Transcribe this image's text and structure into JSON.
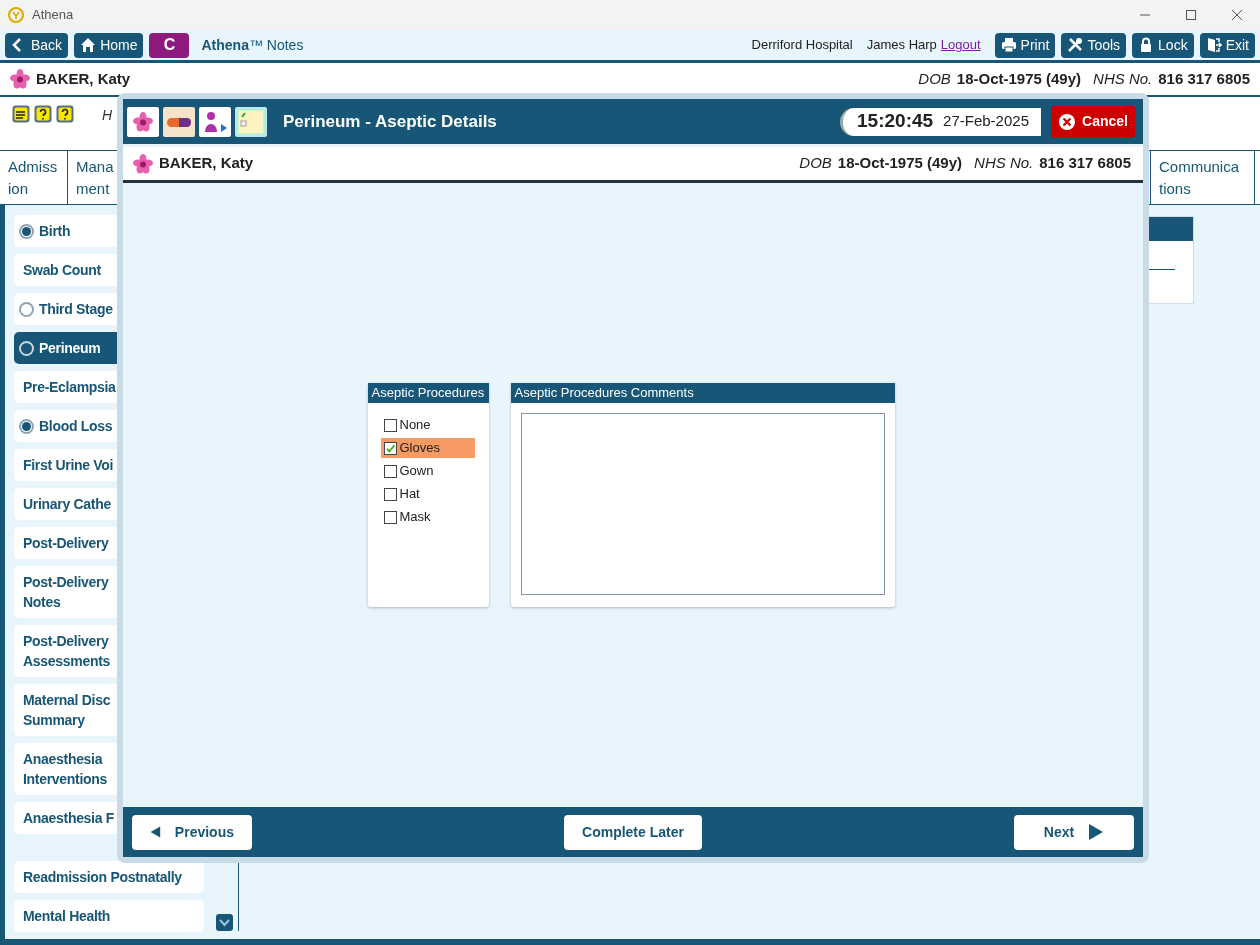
{
  "window": {
    "title": "Athena"
  },
  "toolbar": {
    "nav": [
      {
        "label": "Back",
        "kind": "back"
      },
      {
        "label": "Home",
        "kind": "home"
      }
    ],
    "c_button": "C",
    "app_name": "**Athena**™ Notes",
    "hospital": "Derriford Hospital",
    "user": "James Harp",
    "logout": "Logout",
    "actions": [
      {
        "label": "Print",
        "kind": "print"
      },
      {
        "label": "Tools",
        "kind": "tools"
      },
      {
        "label": "Lock",
        "kind": "lock"
      },
      {
        "label": "Exit",
        "kind": "exit"
      }
    ]
  },
  "patient_banner": {
    "name": "BAKER, Katy",
    "dob_label": "DOB",
    "dob": "18-Oct-1975 (49y)",
    "nhs_label": "NHS No.",
    "nhs": "816 317 6805"
  },
  "info_row": {
    "text": "H"
  },
  "tabs": {
    "left": [
      {
        "lines": [
          "Admiss",
          "ion"
        ]
      },
      {
        "lines": [
          "Mana",
          "ment"
        ]
      }
    ],
    "right": [
      {
        "lines": [
          "Communica",
          "tions"
        ]
      }
    ]
  },
  "sidebar": {
    "items": [
      {
        "label": "Birth",
        "kind": "radio",
        "checked": true,
        "selected": false
      },
      {
        "label": "Swab Count",
        "kind": "plain",
        "selected": false
      },
      {
        "label": "Third Stage",
        "kind": "radio",
        "checked": false,
        "selected": false
      },
      {
        "label": "Perineum",
        "kind": "radio",
        "checked": false,
        "selected": true
      },
      {
        "label": "Pre-Eclampsia",
        "kind": "plain",
        "selected": false
      },
      {
        "label": "Blood Loss",
        "kind": "radio",
        "checked": true,
        "selected": false
      },
      {
        "label": "First Urine Voi",
        "kind": "plain",
        "selected": false
      },
      {
        "label": "Urinary Cathe",
        "kind": "plain",
        "selected": false
      },
      {
        "label": "Post-Delivery",
        "kind": "plain",
        "selected": false
      },
      {
        "label": "Post-Delivery\nNotes",
        "kind": "plain",
        "selected": false
      },
      {
        "label": "Post-Delivery\nAssessments",
        "kind": "plain",
        "selected": false
      },
      {
        "label": "Maternal Disc\nSummary",
        "kind": "plain",
        "selected": false
      },
      {
        "label": "Anaesthesia\nInterventions",
        "kind": "plain",
        "selected": false
      },
      {
        "label": "Anaesthesia F",
        "kind": "plain",
        "selected": false
      }
    ],
    "lower_items": [
      {
        "label": "Readmission Postnatally",
        "selected": false
      },
      {
        "label": "Mental Health",
        "selected": false
      }
    ]
  },
  "dialog": {
    "title": "Perineum - Aseptic Details",
    "time": "15:20:45",
    "date": "27-Feb-2025",
    "cancel": "Cancel",
    "patient": {
      "name": "BAKER, Katy",
      "dob_label": "DOB",
      "dob": "18-Oct-1975 (49y)",
      "nhs_label": "NHS No.",
      "nhs": "816 317 6805"
    },
    "procedures": {
      "title": "Aseptic Procedures",
      "options": [
        {
          "label": "None",
          "checked": false
        },
        {
          "label": "Gloves",
          "checked": true
        },
        {
          "label": "Gown",
          "checked": false
        },
        {
          "label": "Hat",
          "checked": false
        },
        {
          "label": "Mask",
          "checked": false
        }
      ]
    },
    "comments": {
      "title": "Aseptic Procedures Comments"
    },
    "footer": {
      "previous": "Previous",
      "complete_later": "Complete Later",
      "next": "Next"
    }
  }
}
